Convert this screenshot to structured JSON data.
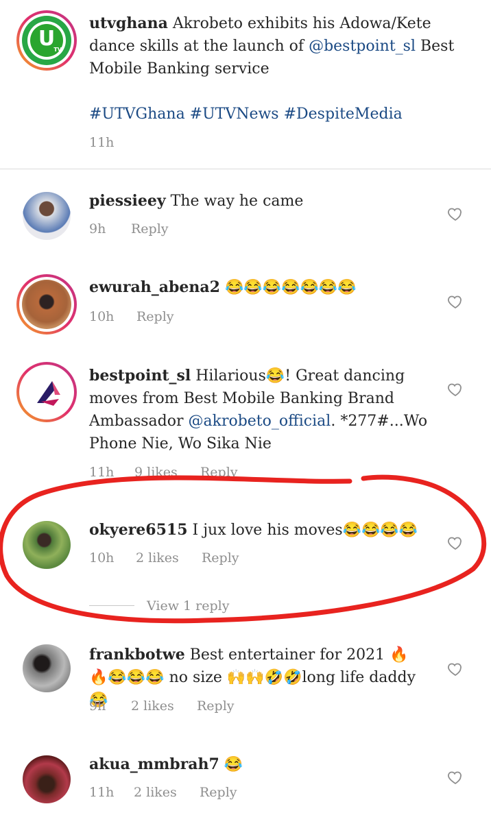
{
  "post": {
    "username": "utvghana",
    "caption": "Akrobeto exhibits his Adowa/Kete dance skills at the launch of",
    "mention": "@bestpoint_sl",
    "caption_tail": "Best Mobile Banking service",
    "hashtags": "#UTVGhana #UTVNews #DespiteMedia",
    "time": "11h",
    "avatar_text": "U",
    "avatar_subtext": "TV"
  },
  "comments": [
    {
      "username": "piessieey",
      "text": "The way he came",
      "time": "9h",
      "likes": "",
      "reply": "Reply"
    },
    {
      "username": "ewurah_abena2",
      "text": "😂😂😂😂😂😂😂",
      "time": "10h",
      "likes": "",
      "reply": "Reply"
    },
    {
      "username": "bestpoint_sl",
      "text_a": "Hilarious😂! Great dancing moves from Best Mobile Banking Brand Ambassador",
      "mention": "@akrobeto_official",
      "text_b": ". *277#...Wo Phone Nie, Wo Sika Nie",
      "time": "11h",
      "likes": "9 likes",
      "reply": "Reply"
    },
    {
      "username": "okyere6515",
      "text": "I jux love his moves😂😂😂😂",
      "time": "10h",
      "likes": "2 likes",
      "reply": "Reply",
      "view_replies": "View 1 reply"
    },
    {
      "username": "frankbotwe",
      "text": "Best entertainer for 2021 🔥🔥😂😂😂 no size 🙌🙌🤣🤣long life daddy😂",
      "time": "9h",
      "likes": "2 likes",
      "reply": "Reply"
    },
    {
      "username": "akua_mmbrah7",
      "text": "😂",
      "time": "11h",
      "likes": "2 likes",
      "reply": "Reply"
    }
  ],
  "colors": {
    "annotation": "#e8231f",
    "link": "#1b4a84",
    "meta": "#8e8e8e"
  }
}
